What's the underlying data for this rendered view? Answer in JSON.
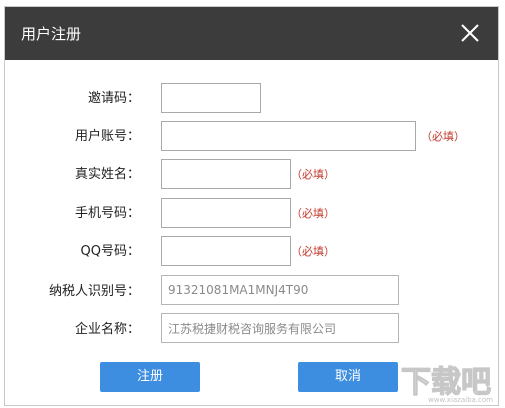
{
  "dialog": {
    "title": "用户注册",
    "close_icon": "close-icon"
  },
  "form": {
    "invite_code": {
      "label": "邀请码：",
      "value": ""
    },
    "account": {
      "label": "用户账号：",
      "value": "",
      "required": "（必填）"
    },
    "real_name": {
      "label": "真实姓名：",
      "value": "",
      "required": "（必填）"
    },
    "phone": {
      "label": "手机号码：",
      "value": "",
      "required": "（必填）"
    },
    "qq": {
      "label": "QQ号码：",
      "value": "",
      "required": "（必填）"
    },
    "tax_id": {
      "label": "纳税人识别号：",
      "value": "91321081MA1MNJ4T90"
    },
    "company": {
      "label": "企业名称：",
      "value": "江苏税捷财税咨询服务有限公司"
    }
  },
  "buttons": {
    "register_label": "注册",
    "cancel_label": "取消"
  },
  "watermark": {
    "text": "下载吧",
    "url": "www.xiazaiba.com"
  },
  "colors": {
    "titlebar": "#3c3c3c",
    "button": "#3d8ee0",
    "required": "#c0392b"
  }
}
